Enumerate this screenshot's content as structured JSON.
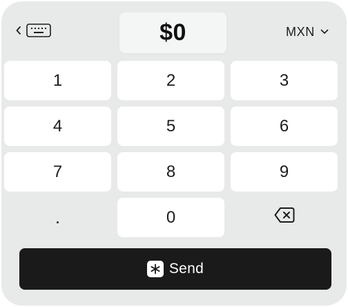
{
  "amount": {
    "value": "$0"
  },
  "currency": {
    "label": "MXN"
  },
  "keypad": {
    "keys": [
      "1",
      "2",
      "3",
      "4",
      "5",
      "6",
      "7",
      "8",
      "9",
      ".",
      "0"
    ]
  },
  "send": {
    "label": "Send"
  },
  "icons": {
    "back": "chevron-left-icon",
    "keyboard": "keyboard-icon",
    "currency_dropdown": "chevron-down-icon",
    "backspace": "backspace-icon",
    "send": "asterisk-icon"
  },
  "colors": {
    "panel_background": "#e8e9e9",
    "key_background": "#ffffff",
    "send_button": "#1a1a1a"
  }
}
